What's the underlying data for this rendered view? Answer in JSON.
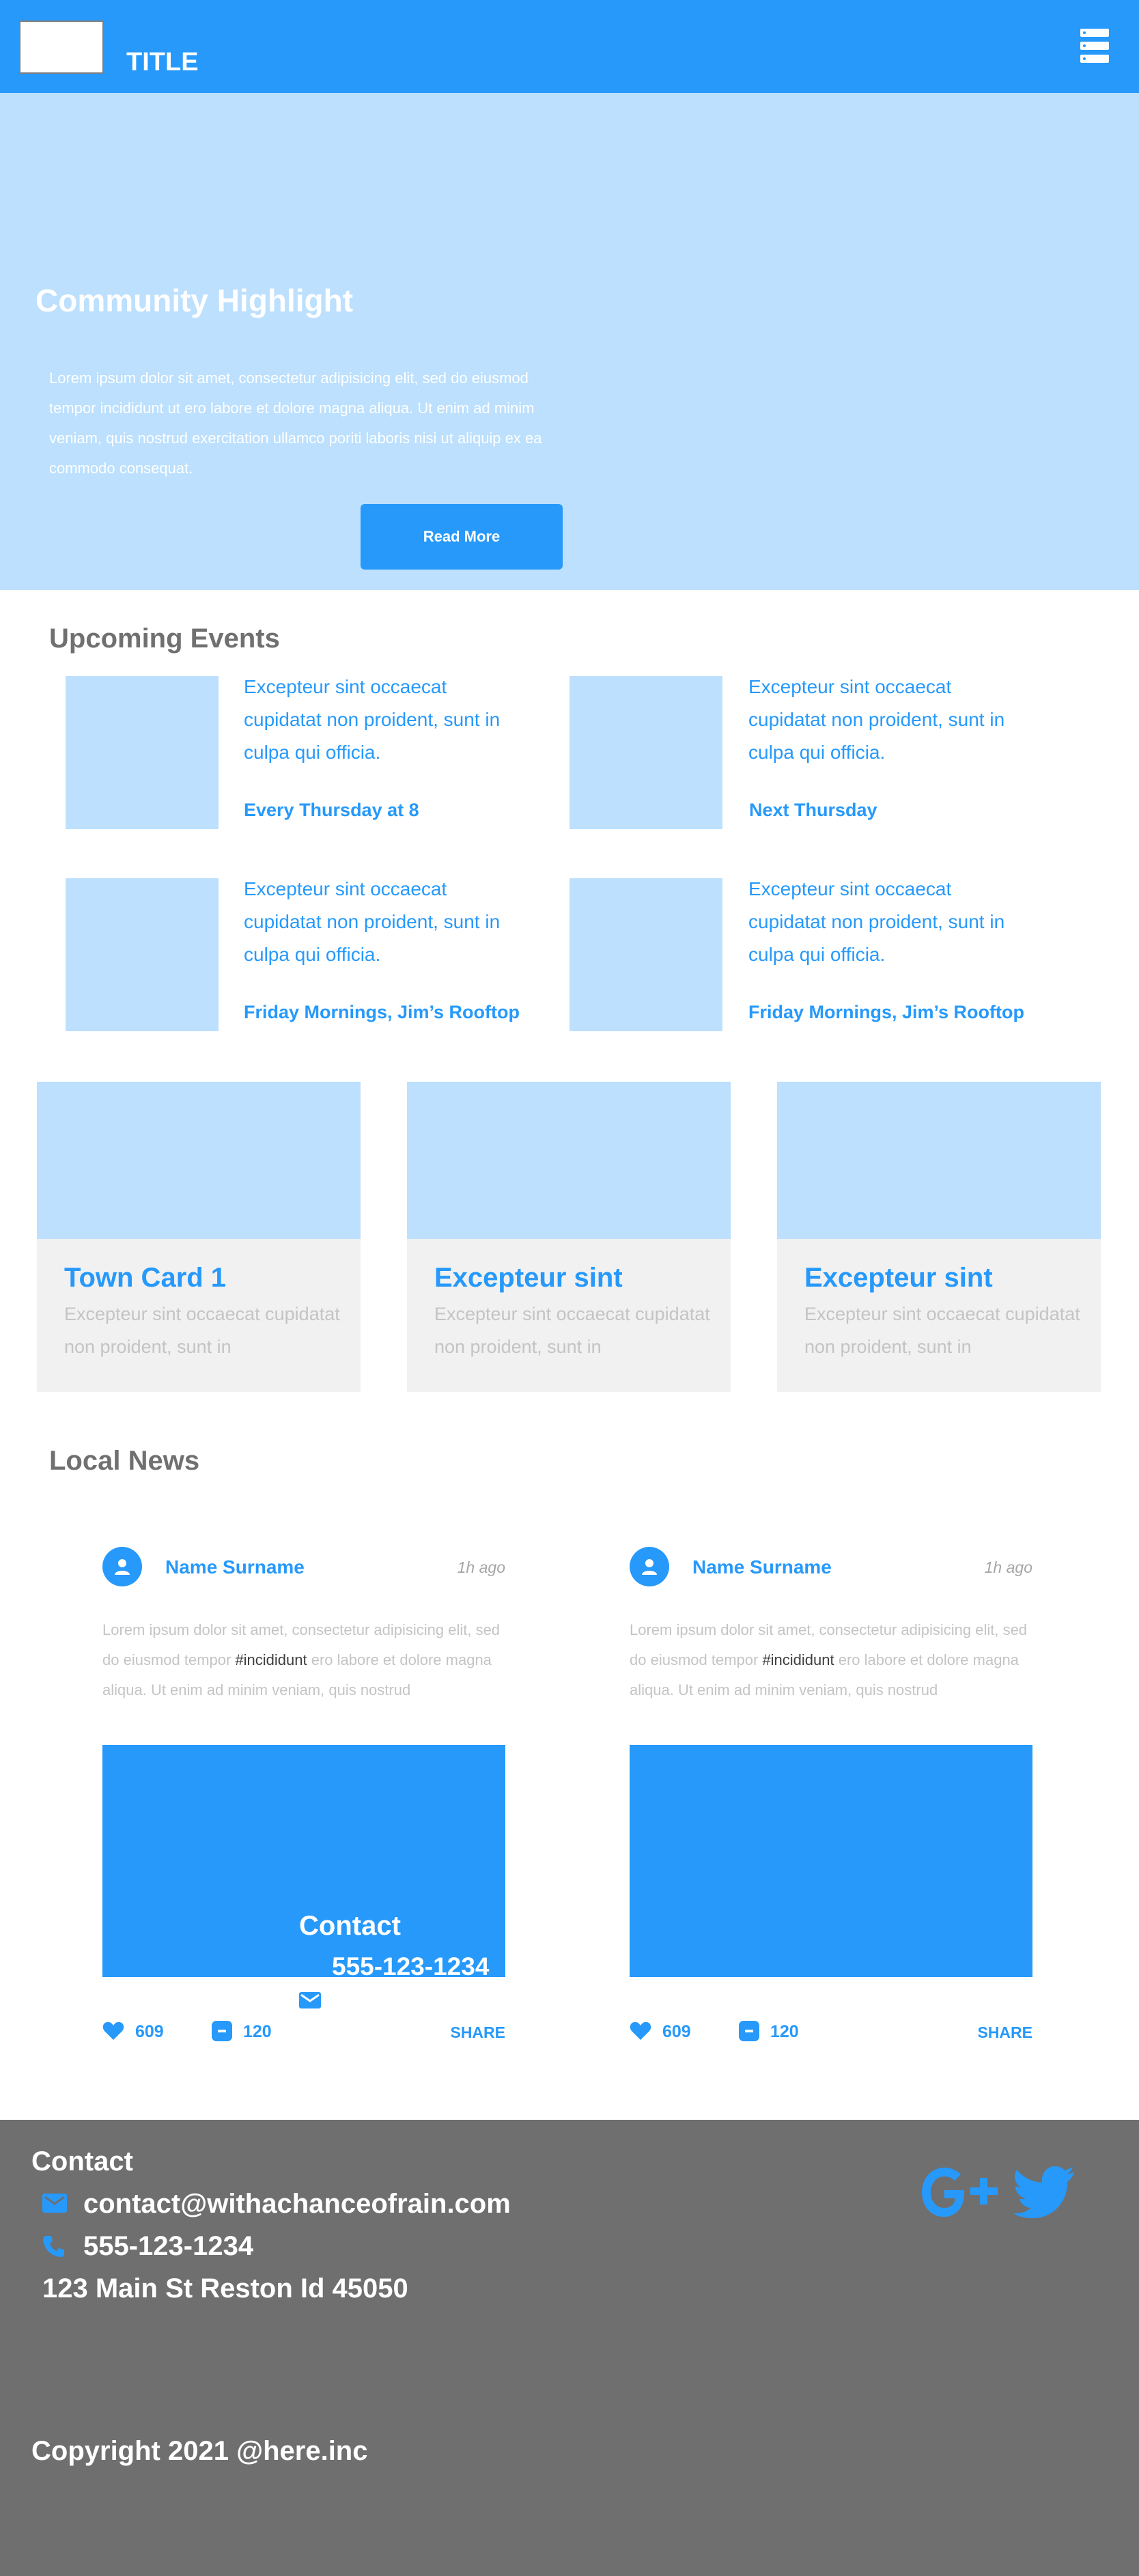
{
  "header": {
    "title": "TITLE"
  },
  "hero": {
    "title": "Community Highlight",
    "text": "Lorem ipsum dolor sit amet, consectetur adipisicing elit, sed do eiusmod tempor incididunt ut ero labore et dolore magna aliqua. Ut enim ad minim veniam, quis nostrud exercitation ullamco poriti laboris nisi ut aliquip ex ea commodo consequat.",
    "button": "Read More"
  },
  "events": {
    "heading": "Upcoming Events",
    "items": [
      {
        "desc": "Excepteur sint occaecat cupidatat non proident, sunt in culpa qui officia.",
        "when": "Every Thursday at 8"
      },
      {
        "desc": "Excepteur sint occaecat cupidatat non proident, sunt in culpa qui officia.",
        "when": "Next Thursday"
      },
      {
        "desc": "Excepteur sint occaecat cupidatat non proident, sunt in culpa qui officia.",
        "when": "Friday Mornings, Jim’s Rooftop"
      },
      {
        "desc": "Excepteur sint occaecat cupidatat non proident, sunt in culpa qui officia.",
        "when": "Friday Mornings, Jim’s Rooftop"
      }
    ]
  },
  "cards": [
    {
      "title": "Town Card 1",
      "text": "Excepteur sint occaecat cupidatat non proident, sunt in"
    },
    {
      "title": "Excepteur sint",
      "text": "Excepteur sint occaecat cupidatat non proident, sunt in"
    },
    {
      "title": "Excepteur sint",
      "text": "Excepteur sint occaecat cupidatat non proident, sunt in"
    }
  ],
  "news": {
    "heading": "Local News",
    "posts": [
      {
        "name": "Name Surname",
        "time": "1h ago",
        "text_before": "Lorem ipsum dolor sit amet, consectetur adipisicing elit, sed do eiusmod tempor ",
        "tag": "#incididunt",
        "text_after": " ero labore et dolore magna aliqua. Ut enim ad minim veniam, quis nostrud",
        "likes": "609",
        "comments": "120",
        "share": "SHARE"
      },
      {
        "name": "Name Surname",
        "time": "1h ago",
        "text_before": "Lorem ipsum dolor sit amet, consectetur adipisicing elit, sed do eiusmod tempor ",
        "tag": "#incididunt",
        "text_after": " ero labore et dolore magna aliqua. Ut enim ad minim veniam, quis nostrud",
        "likes": "609",
        "comments": "120",
        "share": "SHARE"
      }
    ]
  },
  "overlay": {
    "contact": "Contact",
    "phone": "555-123-1234"
  },
  "footer": {
    "contact_heading": "Contact",
    "email": "contact@withachanceofrain.com",
    "phone": "555-123-1234",
    "address": "123 Main St Reston Id 45050",
    "copyright": "Copyright 2021 @here.inc"
  },
  "colors": {
    "primary": "#2699fb",
    "light": "#bce0fd",
    "footer": "#6f6f6f",
    "heading": "#707070"
  }
}
